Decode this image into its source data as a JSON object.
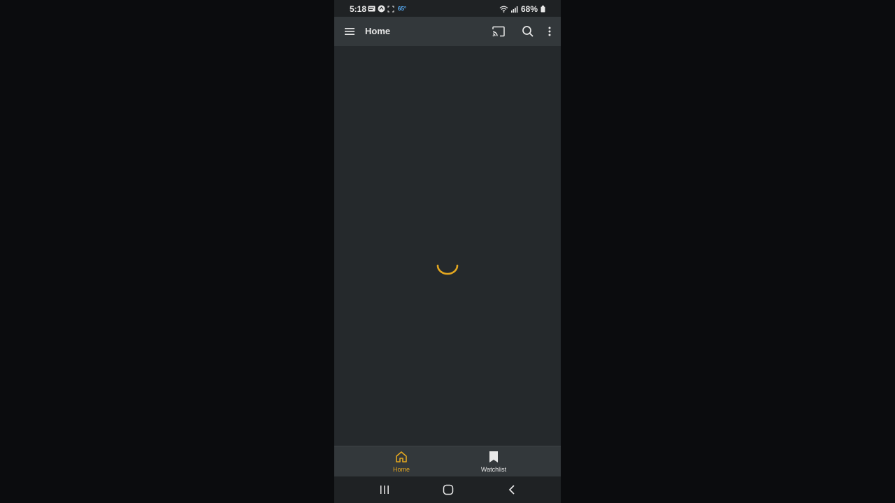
{
  "status_bar": {
    "time": "5:18",
    "temperature": "65°",
    "battery": "68%",
    "icons": [
      "message-icon",
      "app-icon",
      "screenshot-icon",
      "wifi-icon",
      "signal-icon",
      "battery-icon"
    ]
  },
  "app_bar": {
    "title": "Home",
    "icons": [
      "menu-icon",
      "cast-icon",
      "search-icon",
      "more-vert-icon"
    ]
  },
  "content": {
    "state": "loading",
    "spinner_color": "#e2a620"
  },
  "bottom_nav": {
    "items": [
      {
        "label": "Home",
        "icon": "home-icon",
        "active": true
      },
      {
        "label": "Watchlist",
        "icon": "bookmark-icon",
        "active": false
      }
    ]
  },
  "system_nav": {
    "icons": [
      "recents-icon",
      "home-circle-icon",
      "back-icon"
    ]
  },
  "colors": {
    "accent": "#e2a620",
    "app_bar": "#33383b",
    "background": "#25292c"
  }
}
